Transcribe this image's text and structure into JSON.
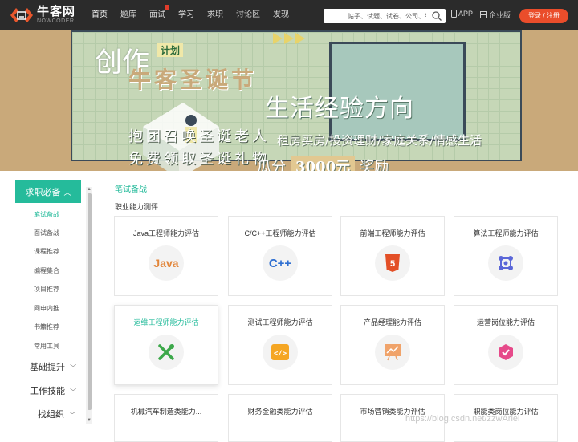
{
  "header": {
    "logo_cn": "牛客网",
    "logo_en": "NOWCODER",
    "nav": [
      {
        "label": "首页",
        "active": true
      },
      {
        "label": "题库"
      },
      {
        "label": "面试",
        "badge": true
      },
      {
        "label": "学习"
      },
      {
        "label": "求职"
      },
      {
        "label": "讨论区"
      },
      {
        "label": "发现"
      }
    ],
    "search_placeholder": "帖子、试题、试卷、公司、牛友",
    "app_label": "APP",
    "enterprise_label": "企业版",
    "login_label": "登录 / 注册"
  },
  "banner": {
    "create": "创作",
    "plan": "计划",
    "xmas": "牛客圣诞节",
    "direction": "生活经验方向",
    "line1": "抱团召唤圣诞老人",
    "line2": "免费领取圣诞礼物",
    "topics": "租房买房/投资理财/家庭关系/情感生活",
    "share_prefix": "瓜分",
    "share_amount": "3000元",
    "share_suffix": "奖励"
  },
  "sidebar": {
    "head": "求职必备",
    "subs": [
      "笔试备战",
      "面试备战",
      "课程推荐",
      "编程集合",
      "项目推荐",
      "网申内推",
      "书籍推荐",
      "常用工具"
    ],
    "groups": [
      "基础提升",
      "工作技能",
      "找组织"
    ]
  },
  "content": {
    "section_title": "笔试备战",
    "section_sub": "职业能力测评",
    "cards": [
      {
        "title": "Java工程师能力评估",
        "icon": "java-icon"
      },
      {
        "title": "C/C++工程师能力评估",
        "icon": "cpp-icon"
      },
      {
        "title": "前端工程师能力评估",
        "icon": "html5-icon"
      },
      {
        "title": "算法工程师能力评估",
        "icon": "algorithm-icon"
      },
      {
        "title": "运维工程师能力评估",
        "icon": "wrench-icon"
      },
      {
        "title": "测试工程师能力评估",
        "icon": "code-window-icon"
      },
      {
        "title": "产品经理能力评估",
        "icon": "chart-board-icon"
      },
      {
        "title": "运营岗位能力评估",
        "icon": "operation-icon"
      },
      {
        "title": "机械汽车制造类能力...",
        "icon": "none"
      },
      {
        "title": "财务金融类能力评估",
        "icon": "none"
      },
      {
        "title": "市场营销类能力评估",
        "icon": "none"
      },
      {
        "title": "职能类岗位能力评估",
        "icon": "none"
      }
    ],
    "icon_labels": {
      "java": "Java",
      "cpp": "C++"
    }
  },
  "watermark": "https://blog.csdn.net/zzwAriel",
  "colors": {
    "accent": "#25bb9b",
    "login": "#ea4d2b",
    "nav_bg": "#2b2b2b"
  }
}
